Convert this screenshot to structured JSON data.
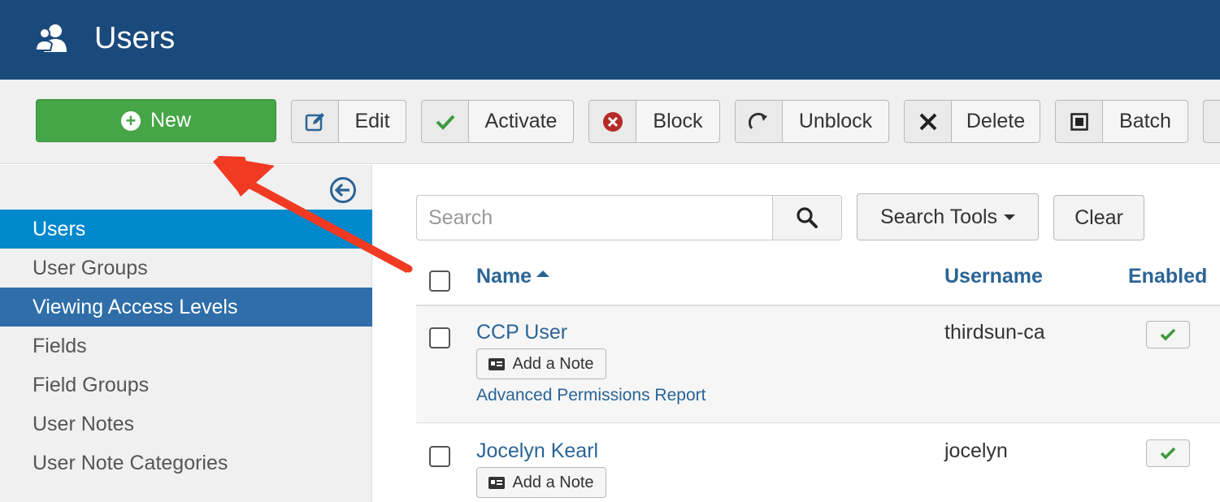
{
  "header": {
    "title": "Users"
  },
  "toolbar": {
    "new_label": "New",
    "edit_label": "Edit",
    "activate_label": "Activate",
    "block_label": "Block",
    "unblock_label": "Unblock",
    "delete_label": "Delete",
    "batch_label": "Batch"
  },
  "sidebar": {
    "items": [
      {
        "label": "Users",
        "state": "active"
      },
      {
        "label": "User Groups",
        "state": "normal"
      },
      {
        "label": "Viewing Access Levels",
        "state": "hover"
      },
      {
        "label": "Fields",
        "state": "normal"
      },
      {
        "label": "Field Groups",
        "state": "normal"
      },
      {
        "label": "User Notes",
        "state": "normal"
      },
      {
        "label": "User Note Categories",
        "state": "normal"
      }
    ]
  },
  "filters": {
    "search_placeholder": "Search",
    "search_tools_label": "Search Tools",
    "clear_label": "Clear"
  },
  "table": {
    "columns": {
      "name": "Name",
      "username": "Username",
      "enabled": "Enabled"
    },
    "rows": [
      {
        "name": "CCP User",
        "note_label": "Add a Note",
        "permissions_link": "Advanced Permissions Report",
        "username": "thirdsun-ca",
        "enabled": true
      },
      {
        "name": "Jocelyn Kearl",
        "note_label": "Add a Note",
        "username": "jocelyn",
        "enabled": true
      }
    ]
  },
  "colors": {
    "header_bg": "#1a4a7c",
    "new_button": "#46a546",
    "sidebar_active": "#0088cc",
    "sidebar_hover": "#2f6ea8",
    "link": "#2a6496",
    "annotation_arrow": "#f03a22"
  },
  "icons": {
    "header": "users-icon",
    "edit": "edit-icon",
    "activate": "check-icon",
    "block": "block-icon",
    "unblock": "unblock-icon",
    "delete": "delete-icon",
    "batch": "batch-icon",
    "collapse": "collapse-sidebar-icon",
    "search": "search-icon",
    "note": "note-card-icon",
    "enabled": "check-icon"
  }
}
